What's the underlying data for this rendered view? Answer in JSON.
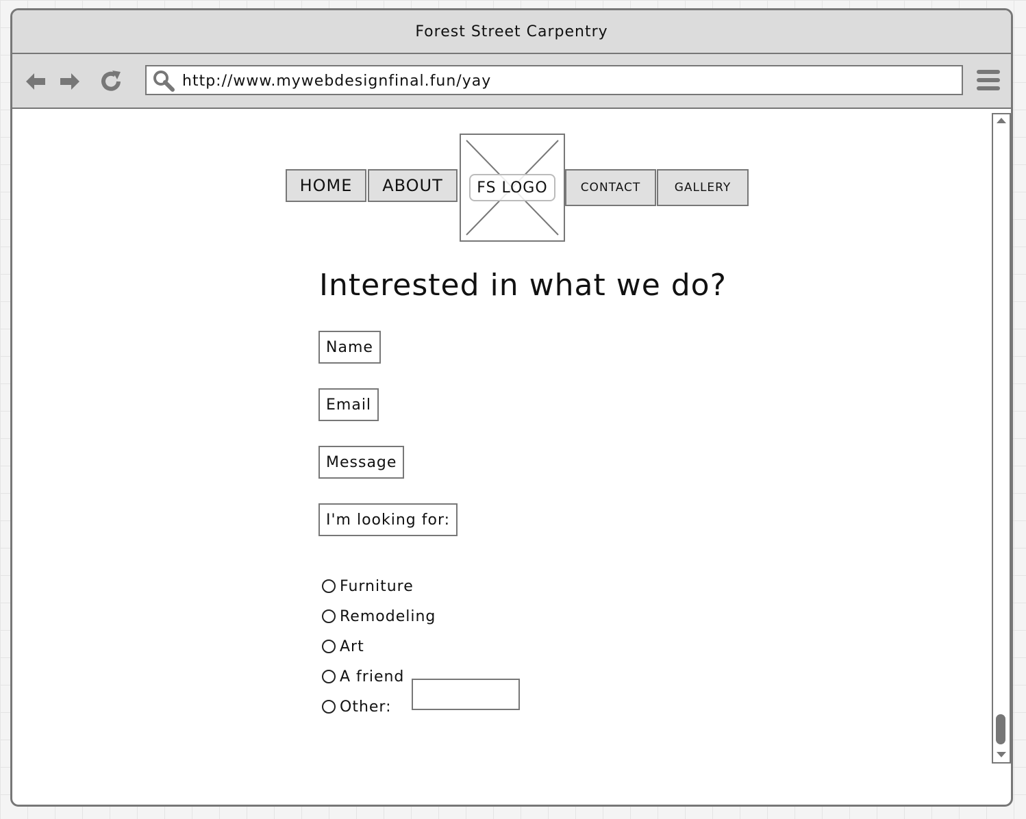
{
  "window": {
    "title": "Forest Street Carpentry"
  },
  "toolbar": {
    "url": "http://www.mywebdesignfinal.fun/yay",
    "back_icon": "arrow-left-icon",
    "forward_icon": "arrow-right-icon",
    "reload_icon": "reload-icon",
    "search_icon": "search-icon",
    "menu_icon": "hamburger-menu-icon"
  },
  "nav": {
    "home": "HOME",
    "about": "ABOUT",
    "logo": "FS LOGO",
    "contact": "CONTACT",
    "gallery": "GALLERY"
  },
  "form": {
    "heading": "Interested in what we do?",
    "name": "Name",
    "email": "Email",
    "message": "Message",
    "looking_for": "I'm looking for:",
    "options": [
      "Furniture",
      "Remodeling",
      "Art",
      "A friend",
      "Other:"
    ],
    "other_value": ""
  },
  "colors": {
    "border": "#777777",
    "chrome": "#dcdcdc",
    "button": "#e0e0e0"
  }
}
